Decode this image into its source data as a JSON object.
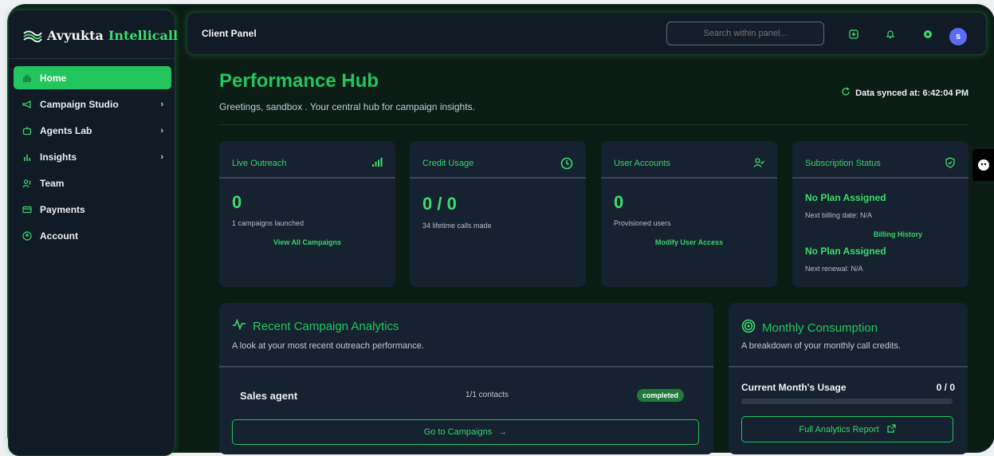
{
  "brand": {
    "name_main": "Avyukta",
    "name_accent": "Intellicall"
  },
  "sidebar": {
    "items": [
      {
        "label": "Home",
        "icon": "home-icon",
        "active": true
      },
      {
        "label": "Campaign Studio",
        "icon": "megaphone-icon",
        "chevron": true
      },
      {
        "label": "Agents Lab",
        "icon": "bot-icon",
        "chevron": true
      },
      {
        "label": "Insights",
        "icon": "bar-chart-icon",
        "chevron": true
      },
      {
        "label": "Team",
        "icon": "users-icon"
      },
      {
        "label": "Payments",
        "icon": "credit-card-icon"
      },
      {
        "label": "Account",
        "icon": "account-icon"
      }
    ]
  },
  "topbar": {
    "title": "Client Panel",
    "search_placeholder": "Search within panel...",
    "avatar_initial": "s"
  },
  "header": {
    "title": "Performance Hub",
    "greeting": "Greetings, sandbox . Your central hub for campaign insights.",
    "sync_text": "Data synced at: 6:42:04 PM"
  },
  "cards": {
    "outreach": {
      "title": "Live Outreach",
      "value": "0",
      "sub": "1 campaigns launched",
      "link": "View All Campaigns"
    },
    "credit": {
      "title": "Credit Usage",
      "value": "0 / 0",
      "sub": "34 lifetime calls made"
    },
    "users": {
      "title": "User Accounts",
      "value": "0",
      "sub": "Provisioned users",
      "link": "Modify User Access"
    },
    "subscription": {
      "title": "Subscription Status",
      "plan1": "No Plan Assigned",
      "billing": "Next billing date: N/A",
      "link": "Billing History",
      "plan2": "No Plan Assigned",
      "renewal": "Next renewal: N/A"
    }
  },
  "analytics": {
    "title": "Recent Campaign Analytics",
    "desc": "A look at your most recent outreach performance.",
    "row": {
      "name": "Sales agent",
      "contacts": "1/1 contacts",
      "status": "completed"
    },
    "button": "Go to Campaigns"
  },
  "consumption": {
    "title": "Monthly Consumption",
    "desc": "A breakdown of your monthly call credits.",
    "usage_label": "Current Month's Usage",
    "usage_value": "0 / 0",
    "usage_fraction": 0,
    "button": "Full Analytics Report"
  },
  "colors": {
    "accent": "#22c55e",
    "bg": "#0c1d16",
    "panel": "#162230"
  }
}
